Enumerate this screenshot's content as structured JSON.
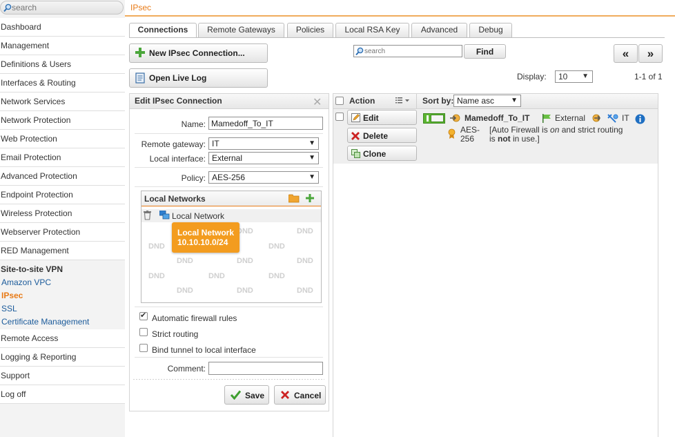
{
  "sidebar": {
    "search_placeholder": "search",
    "items": [
      "Dashboard",
      "Management",
      "Definitions & Users",
      "Interfaces & Routing",
      "Network Services",
      "Network Protection",
      "Web Protection",
      "Email Protection",
      "Advanced Protection",
      "Endpoint Protection",
      "Wireless Protection",
      "Webserver Protection",
      "RED Management"
    ],
    "section": "Site-to-site VPN",
    "sub_items": [
      "Amazon VPC",
      "IPsec",
      "SSL",
      "Certificate Management"
    ],
    "active_sub_item": "IPsec",
    "after_items": [
      "Remote Access",
      "Logging & Reporting",
      "Support",
      "Log off"
    ]
  },
  "header": {
    "title": "IPsec"
  },
  "tabs": [
    "Connections",
    "Remote Gateways",
    "Policies",
    "Local RSA Key",
    "Advanced",
    "Debug"
  ],
  "active_tab": "Connections",
  "toolbar": {
    "new_button": "New IPsec Connection...",
    "live_log_button": "Open Live Log",
    "search_placeholder": "search",
    "find_button": "Find",
    "prev_page": "«",
    "next_page": "»",
    "display_label": "Display:",
    "display_value": "10",
    "page_range": "1-1 of 1"
  },
  "edit_panel": {
    "title": "Edit IPsec Connection",
    "name_label": "Name:",
    "name_value": "Mamedoff_To_IT",
    "remote_gateway_label": "Remote gateway:",
    "remote_gateway_value": "IT",
    "local_interface_label": "Local interface:",
    "local_interface_value": "External",
    "policy_label": "Policy:",
    "policy_value": "AES-256",
    "local_networks_title": "Local Networks",
    "local_network_item": "Local Network",
    "dnd_text": "DND",
    "tooltip_name": "Local Network",
    "tooltip_address": "10.10.10.0/24",
    "auto_firewall_label": "Automatic firewall rules",
    "auto_firewall_checked": true,
    "strict_routing_label": "Strict routing",
    "strict_routing_checked": false,
    "bind_tunnel_label": "Bind tunnel to local interface",
    "bind_tunnel_checked": false,
    "comment_label": "Comment:",
    "comment_value": "",
    "save_button": "Save",
    "cancel_button": "Cancel"
  },
  "list_panel": {
    "action_header": "Action",
    "sort_label": "Sort by:",
    "sort_value": "Name asc",
    "row": {
      "edit_button": "Edit",
      "delete_button": "Delete",
      "clone_button": "Clone",
      "name": "Mamedoff_To_IT",
      "interface": "External",
      "gateway": "IT",
      "policy_line1": "AES-",
      "policy_line2": "256",
      "note_prefix": "[Auto Firewall is ",
      "note_on": "on",
      "note_middle": " and strict routing",
      "note_is": "is ",
      "note_not": "not",
      "note_suffix": " in use.]",
      "enabled": true
    }
  },
  "colors": {
    "accent": "#e87a16",
    "link": "#1a5a9a",
    "toggle_on": "#5cb531",
    "delete_red": "#cc2222",
    "tooltip": "#f39c1f",
    "info_blue": "#1f6fc2"
  }
}
